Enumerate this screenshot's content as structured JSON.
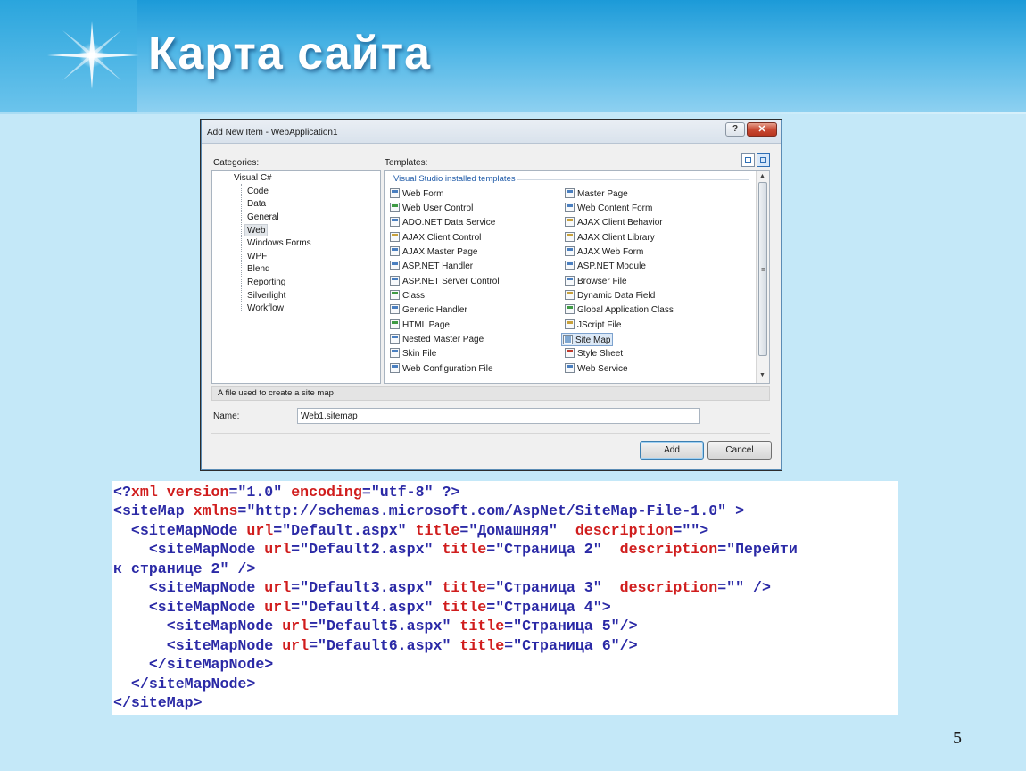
{
  "slide": {
    "title": "Карта сайта",
    "page_number": "5"
  },
  "dialog": {
    "title": "Add New Item - WebApplication1",
    "help_label": "?",
    "close_label": "✕",
    "categories_label": "Categories:",
    "templates_label": "Templates:",
    "categories": [
      {
        "label": "Visual C#"
      },
      {
        "label": "Code"
      },
      {
        "label": "Data"
      },
      {
        "label": "General"
      },
      {
        "label": "Web",
        "selected": true
      },
      {
        "label": "Windows Forms"
      },
      {
        "label": "WPF"
      },
      {
        "label": "Blend"
      },
      {
        "label": "Reporting"
      },
      {
        "label": "Silverlight"
      },
      {
        "label": "Workflow"
      }
    ],
    "template_group": "Visual Studio installed templates",
    "templates_left": [
      "Web Form",
      "Web User Control",
      "ADO.NET Data Service",
      "AJAX Client Control",
      "AJAX Master Page",
      "ASP.NET Handler",
      "ASP.NET Server Control",
      "Class",
      "Generic Handler",
      "HTML Page",
      "Nested Master Page",
      "Skin File",
      "Web Configuration File"
    ],
    "templates_right": [
      "Master Page",
      "Web Content Form",
      "AJAX Client Behavior",
      "AJAX Client Library",
      "AJAX Web Form",
      "ASP.NET Module",
      "Browser File",
      "Dynamic Data Field",
      "Global Application Class",
      "JScript File",
      "Site Map",
      "Style Sheet",
      "Web Service"
    ],
    "selected_template": "Site Map",
    "description": "A file used to create a site map",
    "name_label": "Name:",
    "name_value": "Web1.sitemap",
    "add_label": "Add",
    "cancel_label": "Cancel"
  },
  "code": {
    "lines": [
      [
        [
          "t",
          "<?"
        ],
        [
          "a",
          "xml version"
        ],
        [
          "v",
          "=\"1.0\" "
        ],
        [
          "a",
          "encoding"
        ],
        [
          "v",
          "=\"utf-8\" "
        ],
        [
          "t",
          "?>"
        ]
      ],
      [
        [
          "t",
          "<siteMap "
        ],
        [
          "a",
          "xmlns"
        ],
        [
          "v",
          "=\"http://schemas.microsoft.com/AspNet/SiteMap-File-1.0\" "
        ],
        [
          "t",
          ">"
        ]
      ],
      [
        [
          "t",
          "  <siteMapNode "
        ],
        [
          "a",
          "url"
        ],
        [
          "v",
          "=\"Default.aspx\" "
        ],
        [
          "a",
          "title"
        ],
        [
          "v",
          "=\"Домашняя\"  "
        ],
        [
          "a",
          "description"
        ],
        [
          "v",
          "=\"\">"
        ]
      ],
      [
        [
          "t",
          "    <siteMapNode "
        ],
        [
          "a",
          "url"
        ],
        [
          "v",
          "=\"Default2.aspx\" "
        ],
        [
          "a",
          "title"
        ],
        [
          "v",
          "=\"Страница 2\"  "
        ],
        [
          "a",
          "description"
        ],
        [
          "v",
          "=\"Перейти"
        ]
      ],
      [
        [
          "v",
          "к странице 2\" />"
        ]
      ],
      [
        [
          "t",
          "    <siteMapNode "
        ],
        [
          "a",
          "url"
        ],
        [
          "v",
          "=\"Default3.aspx\" "
        ],
        [
          "a",
          "title"
        ],
        [
          "v",
          "=\"Страница 3\"  "
        ],
        [
          "a",
          "description"
        ],
        [
          "v",
          "=\"\" />"
        ]
      ],
      [
        [
          "t",
          "    <siteMapNode "
        ],
        [
          "a",
          "url"
        ],
        [
          "v",
          "=\"Default4.aspx\" "
        ],
        [
          "a",
          "title"
        ],
        [
          "v",
          "=\"Страница 4\">"
        ]
      ],
      [
        [
          "t",
          "      <siteMapNode "
        ],
        [
          "a",
          "url"
        ],
        [
          "v",
          "=\"Default5.aspx\" "
        ],
        [
          "a",
          "title"
        ],
        [
          "v",
          "=\"Страница 5\"/>"
        ]
      ],
      [
        [
          "t",
          "      <siteMapNode "
        ],
        [
          "a",
          "url"
        ],
        [
          "v",
          "=\"Default6.aspx\" "
        ],
        [
          "a",
          "title"
        ],
        [
          "v",
          "=\"Страница 6\"/>"
        ]
      ],
      [
        [
          "t",
          "    </siteMapNode>"
        ]
      ],
      [
        [
          "t",
          "  </siteMapNode>"
        ]
      ],
      [
        [
          "t",
          "</siteMap>"
        ]
      ]
    ]
  },
  "colors": {
    "code_tag": "#2b2aa6",
    "code_attr": "#d01d1d",
    "slide_bg": "#c4e8f8"
  }
}
